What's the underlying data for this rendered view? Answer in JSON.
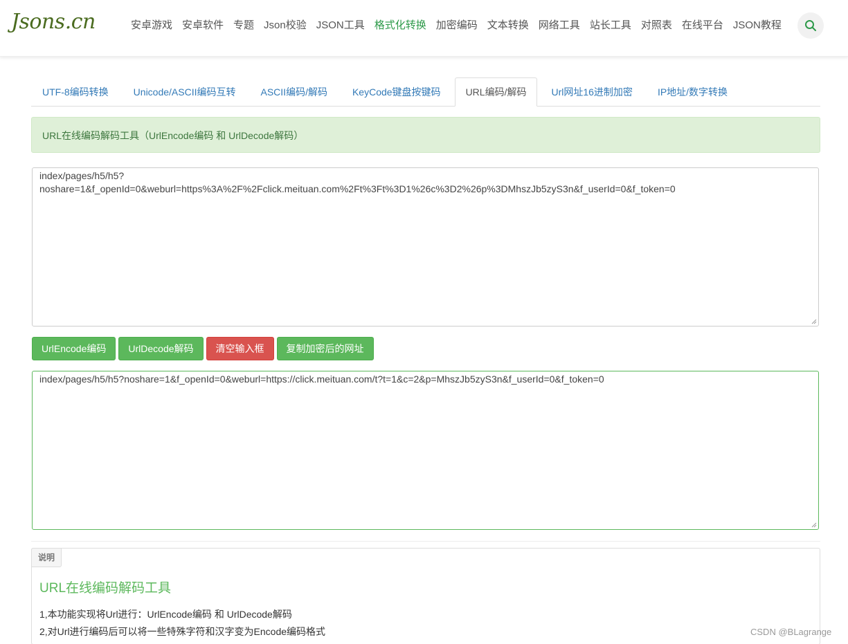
{
  "header": {
    "logo": "Jsons.cn",
    "nav": [
      {
        "label": "安卓游戏"
      },
      {
        "label": "安卓软件"
      },
      {
        "label": "专题"
      },
      {
        "label": "Json校验"
      },
      {
        "label": "JSON工具"
      },
      {
        "label": "格式化转换",
        "active": true
      },
      {
        "label": "加密编码"
      },
      {
        "label": "文本转换"
      },
      {
        "label": "网络工具"
      },
      {
        "label": "站长工具"
      },
      {
        "label": "对照表"
      },
      {
        "label": "在线平台"
      },
      {
        "label": "JSON教程"
      }
    ],
    "search_icon": "search-icon"
  },
  "tabs": [
    {
      "label": "UTF-8编码转换"
    },
    {
      "label": "Unicode/ASCII编码互转"
    },
    {
      "label": "ASCII编码/解码"
    },
    {
      "label": "KeyCode键盘按键码"
    },
    {
      "label": "URL编码/解码",
      "active": true
    },
    {
      "label": "Url网址16进制加密"
    },
    {
      "label": "IP地址/数字转换"
    }
  ],
  "alert": {
    "text": "URL在线编码解码工具（UrlEncode编码 和 UrlDecode解码）"
  },
  "input": {
    "value": "index/pages/h5/h5?\nnoshare=1&f_openId=0&weburl=https%3A%2F%2Fclick.meituan.com%2Ft%3Ft%3D1%26c%3D2%26p%3DMhszJb5zyS3n&f_userId=0&f_token=0"
  },
  "buttons": {
    "encode": "UrlEncode编码",
    "decode": "UrlDecode解码",
    "clear": "清空输入框",
    "copy": "复制加密后的网址"
  },
  "output": {
    "value": "index/pages/h5/h5?noshare=1&f_openId=0&weburl=https://click.meituan.com/t?t=1&c=2&p=MhszJb5zyS3n&f_userId=0&f_token=0"
  },
  "panel": {
    "tag": "说明",
    "title": "URL在线编码解码工具",
    "lines": [
      "1,本功能实现将Url进行：UrlEncode编码 和 UrlDecode解码",
      "2,对Url进行编码后可以将一些特殊字符和汉字变为Encode编码格式"
    ]
  },
  "watermark": "CSDN @BLagrange",
  "colors": {
    "accent_green": "#5cb85c",
    "active_nav": "#2e9a4a",
    "danger": "#d9534f",
    "link": "#337ab7",
    "alert_bg": "#dff0d8"
  }
}
